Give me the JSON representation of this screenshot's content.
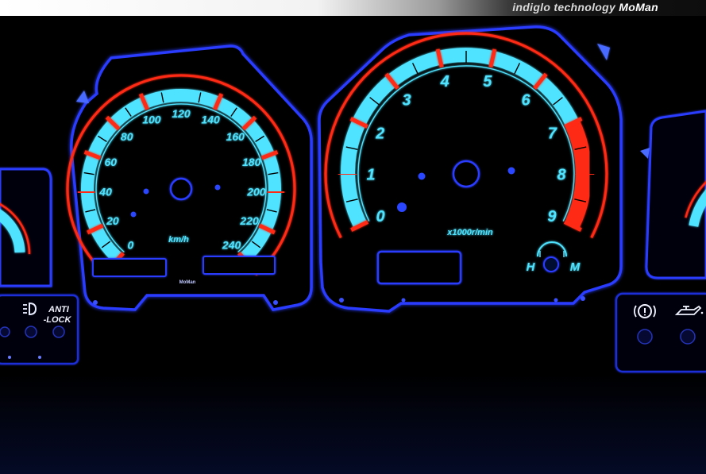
{
  "banner": {
    "prefix": "indiglo technology",
    "brand": "MoMan"
  },
  "speedometer": {
    "unit": "km/h",
    "brand_mark": "MoMan",
    "tick_labels": [
      "0",
      "20",
      "40",
      "60",
      "80",
      "100",
      "120",
      "140",
      "160",
      "180",
      "200",
      "220",
      "240"
    ]
  },
  "tachometer": {
    "unit": "x1000r/min",
    "tick_labels": [
      "0",
      "1",
      "2",
      "3",
      "4",
      "5",
      "6",
      "7",
      "8",
      "9"
    ],
    "temp_labels": {
      "cold": "H",
      "hot": "M"
    }
  },
  "warning_panel": {
    "anti_lock_line1": "ANTI",
    "anti_lock_line2": "-LOCK"
  },
  "colors": {
    "backlight_cyan": "#4fe3ff",
    "redline": "#ff2a12",
    "trim_blue": "#2a3cff",
    "background": "#000000"
  },
  "icons": [
    "headlight-icon",
    "brake-warning-icon",
    "oil-pressure-icon",
    "temperature-icon"
  ]
}
